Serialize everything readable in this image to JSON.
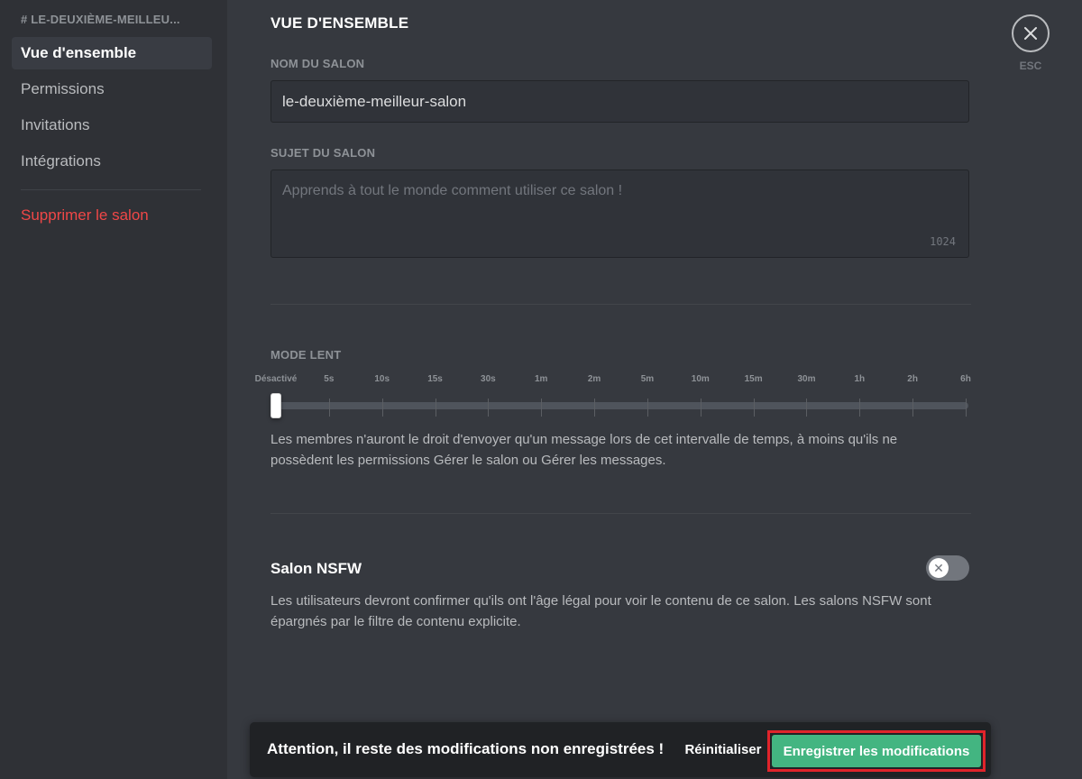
{
  "sidebar": {
    "header": "# LE-DEUXIÈME-MEILLEU...",
    "items": [
      {
        "label": "Vue d'ensemble",
        "active": true
      },
      {
        "label": "Permissions"
      },
      {
        "label": "Invitations"
      },
      {
        "label": "Intégrations"
      }
    ],
    "delete_label": "Supprimer le salon"
  },
  "main": {
    "title": "VUE D'ENSEMBLE",
    "channel_name": {
      "label": "NOM DU SALON",
      "value": "le-deuxième-meilleur-salon"
    },
    "channel_topic": {
      "label": "SUJET DU SALON",
      "placeholder": "Apprends à tout le monde comment utiliser ce salon !",
      "char_count": "1024"
    },
    "slowmode": {
      "label": "MODE LENT",
      "ticks": [
        "Désactivé",
        "5s",
        "10s",
        "15s",
        "30s",
        "1m",
        "2m",
        "5m",
        "10m",
        "15m",
        "30m",
        "1h",
        "2h",
        "6h"
      ],
      "selected_index": 0,
      "help": "Les membres n'auront le droit d'envoyer qu'un message lors de cet intervalle de temps, à moins qu'ils ne possèdent les permissions Gérer le salon ou Gérer les messages."
    },
    "nsfw": {
      "label": "Salon NSFW",
      "enabled": false,
      "help": "Les utilisateurs devront confirmer qu'ils ont l'âge légal pour voir le contenu de ce salon. Les salons NSFW sont épargnés par le filtre de contenu explicite."
    }
  },
  "close": {
    "label": "ESC",
    "icon": "close-icon"
  },
  "notice": {
    "text": "Attention, il reste des modifications non enregistrées !",
    "reset_label": "Réinitialiser",
    "save_label": "Enregistrer les modifications"
  },
  "colors": {
    "accent": "#7289da",
    "danger": "#f04747",
    "save": "#43b581",
    "highlight": "#e0242b"
  }
}
